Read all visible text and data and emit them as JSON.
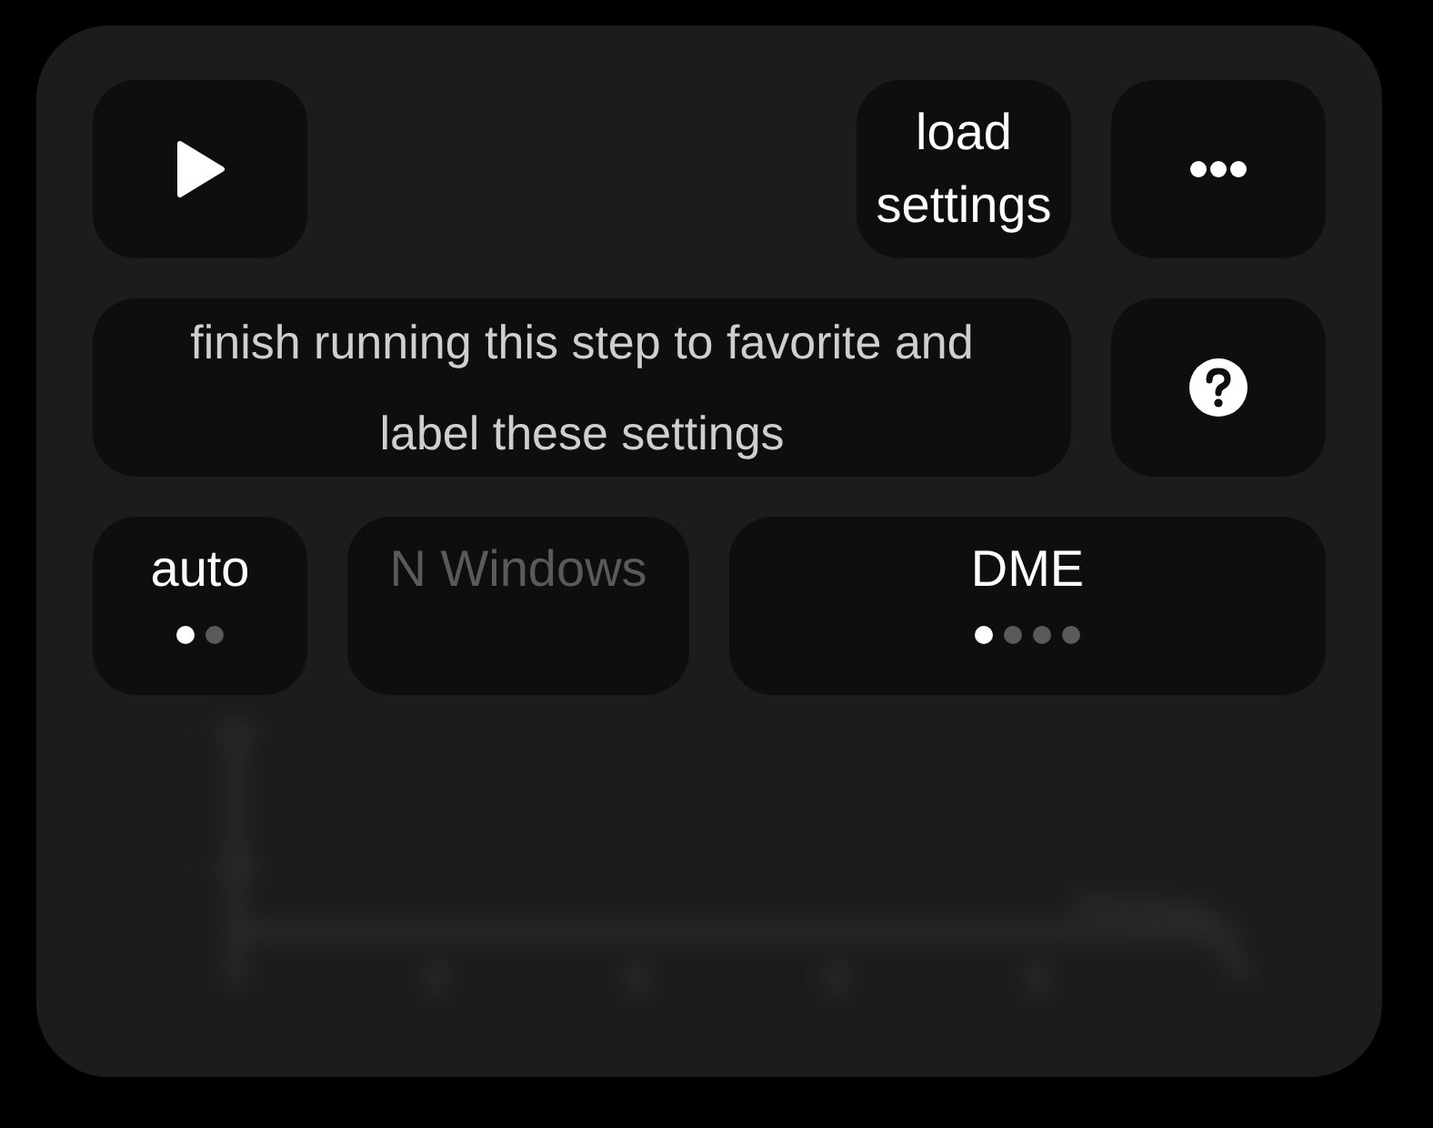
{
  "toolbar": {
    "load_button": "load settings"
  },
  "message": "finish running this step to favorite and label these settings",
  "selectors": [
    {
      "label": "auto",
      "disabled": false,
      "pages": [
        {
          "selected": true
        },
        {
          "selected": false
        }
      ]
    },
    {
      "label": "N Windows",
      "disabled": true
    },
    {
      "label": "DME",
      "disabled": false,
      "pages": [
        {
          "selected": true
        },
        {
          "selected": false
        },
        {
          "selected": false
        },
        {
          "selected": false
        }
      ]
    }
  ]
}
